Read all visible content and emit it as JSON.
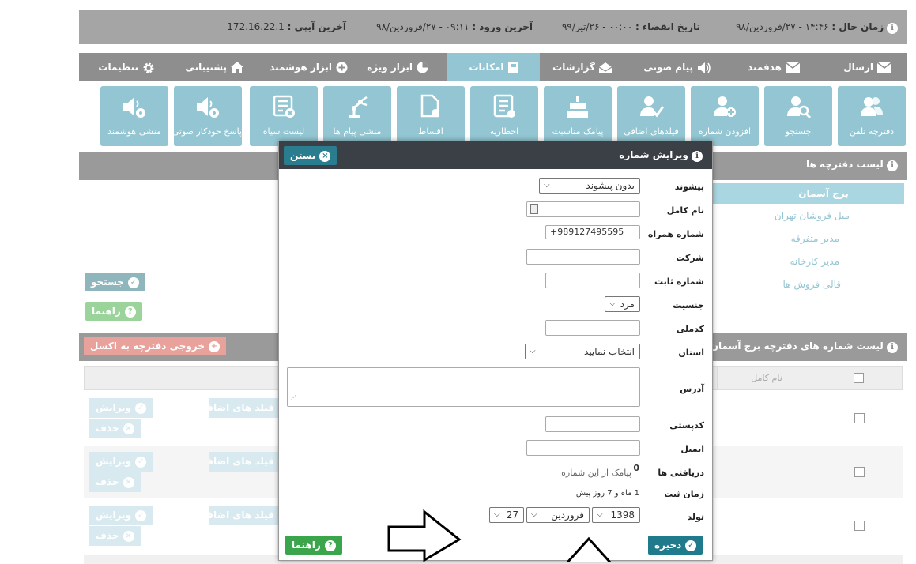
{
  "topbar": {
    "now_label": "زمان حال :",
    "now_value": "۱۴:۴۶ - ۲۷/فروردین/۹۸",
    "expire_label": "تاریخ انقضاء :",
    "expire_value": "۰۰:۰۰ - ۲۶/تیر/۹۹",
    "login_label": "آخرین ورود :",
    "login_value": "۰۹:۱۱ - ۲۷/فروردین/۹۸",
    "ip_label": "آخرین آیپی :",
    "ip_value": "172.16.22.1"
  },
  "nav": {
    "tabs": [
      "ارسال",
      "هدفمند",
      "پیام صوتی",
      "گزارشات",
      "امکانات",
      "ابزار ویژه",
      "ابزار هوشمند",
      "پشتیبانی",
      "تنظیمات"
    ],
    "active": "امکانات"
  },
  "tiles": [
    "دفترچه تلفن",
    "جستجو",
    "افزودن شماره",
    "فیلدهای اضافی",
    "پیامک مناسبت",
    "اخطاریه",
    "اقساط",
    "منشی پیام ها",
    "لیست سیاه",
    "پاسخ خودکار صوتی",
    "منشی هوشمند"
  ],
  "phonebooks": {
    "title": "لیست دفترچه ها",
    "items": [
      "برج آسمان",
      "مبل فروشان تهران",
      "مدیر متفرقه",
      "مدیر کارخانه",
      "قالی فروش ها"
    ]
  },
  "search_panel": {
    "search_button": "جستجو",
    "help_button": "راهنما"
  },
  "numbers": {
    "title": "لیست شماره های دفترچه برج آسمان",
    "export_button": "خروجی دفترچه به اکسل",
    "col_fullname": "نام کامل",
    "extra_fields": "فیلد های اضافی",
    "edit": "ویرایش",
    "delete": "حذف"
  },
  "modal": {
    "title": "ویرایش شماره",
    "close": "بستن",
    "labels": {
      "prefix": "پیشوند",
      "fullname": "نام کامل",
      "mobile": "شماره همراه",
      "company": "شرکت",
      "phone": "شماره ثابت",
      "gender": "جنسیت",
      "national_code": "کدملی",
      "province": "استان",
      "address": "آدرس",
      "postal": "کدپستی",
      "email": "ایمیل",
      "received": "دریافتی ها",
      "reg_time": "زمان ثبت",
      "birth": "تولد"
    },
    "values": {
      "prefix": "بدون پیشوند",
      "mobile": "+989127495595",
      "gender": "مرد",
      "province": "انتخاب نمایید",
      "received_count": "0",
      "received_text": "پیامک از این شماره",
      "reg_time": "1 ماه و 7 روز پیش",
      "birth_year": "1398",
      "birth_month": "فروردین",
      "birth_day": "27"
    },
    "save": "ذخیره",
    "help": "راهنما"
  }
}
